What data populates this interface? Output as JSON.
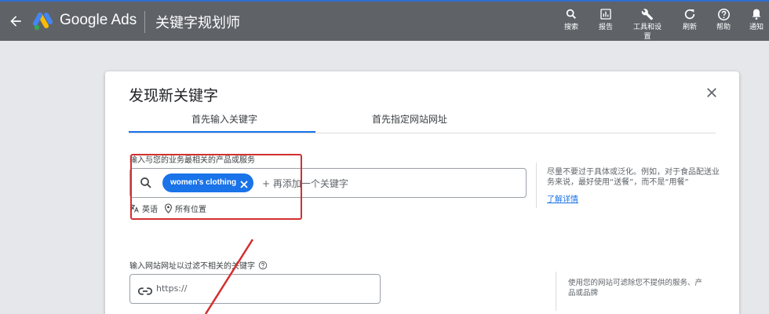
{
  "header": {
    "brand": "Google Ads",
    "page_title": "关键字规划师",
    "nav": [
      {
        "label": "搜索",
        "icon": "search-icon"
      },
      {
        "label": "报告",
        "icon": "reports-icon"
      },
      {
        "label": "工具和设置",
        "icon": "wrench-icon"
      },
      {
        "label": "刷新",
        "icon": "refresh-icon"
      },
      {
        "label": "帮助",
        "icon": "help-icon"
      },
      {
        "label": "通知",
        "icon": "bell-icon"
      }
    ]
  },
  "modal": {
    "title": "发现新关键字",
    "tabs": [
      {
        "label": "首先输入关键字",
        "active": true
      },
      {
        "label": "首先指定网站网址",
        "active": false
      }
    ],
    "keyword_section": {
      "label": "输入与您的业务最相关的产品或服务",
      "chip": "women's clothing",
      "placeholder": "+ 再添加一个关键字",
      "language": "英语",
      "location": "所有位置",
      "tip": "尽量不要过于具体或泛化。例如，对于食品配送业务来说，最好使用“送餐”，而不是“用餐”",
      "tip_link": "了解详情"
    },
    "url_section": {
      "label": "输入网站网址以过滤不相关的关键字",
      "placeholder": "https://",
      "tip": "使用您的网站可滤除您不提供的服务、产品或品牌"
    }
  },
  "colors": {
    "topbar": "#5f6368",
    "accent": "#1a73e8",
    "annotation": "#d32f2f"
  }
}
